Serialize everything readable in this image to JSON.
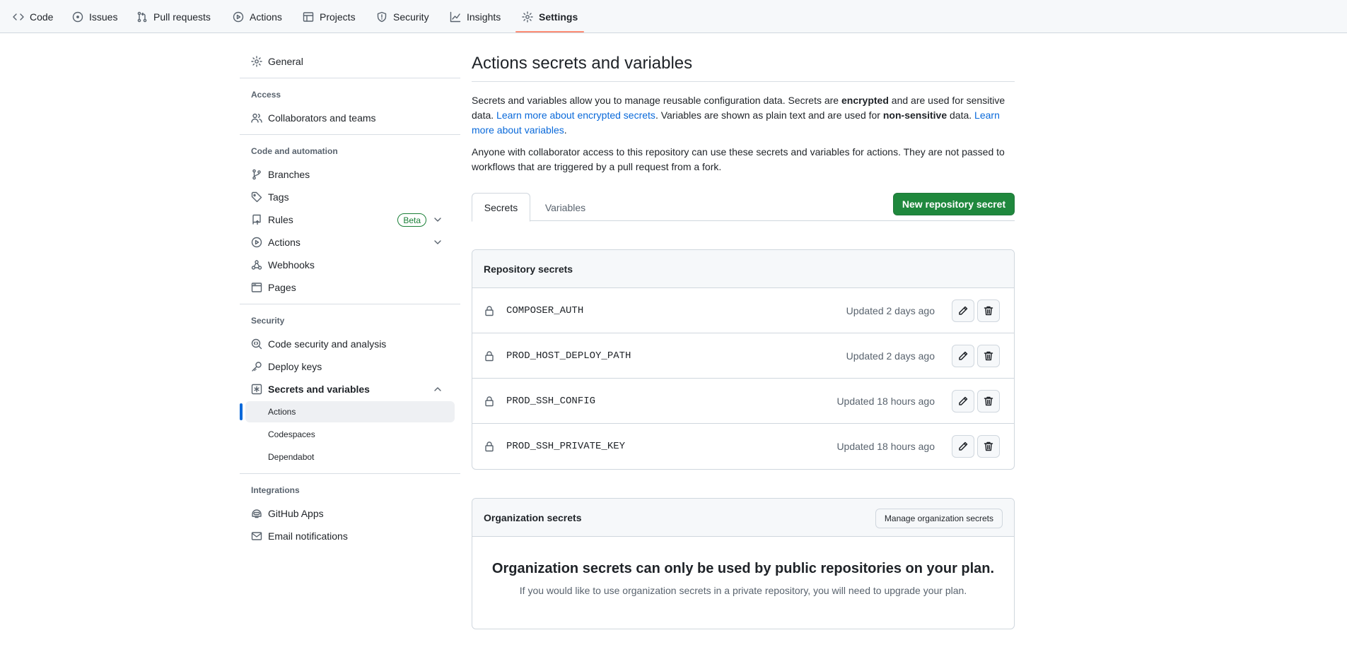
{
  "repo_nav": {
    "tabs": [
      {
        "label": "Code",
        "icon": "code-icon"
      },
      {
        "label": "Issues",
        "icon": "issue-icon"
      },
      {
        "label": "Pull requests",
        "icon": "pull-request-icon"
      },
      {
        "label": "Actions",
        "icon": "play-icon"
      },
      {
        "label": "Projects",
        "icon": "table-icon"
      },
      {
        "label": "Security",
        "icon": "shield-icon"
      },
      {
        "label": "Insights",
        "icon": "graph-icon"
      },
      {
        "label": "Settings",
        "icon": "gear-icon",
        "active": true
      }
    ]
  },
  "sidebar": {
    "general": "General",
    "access_heading": "Access",
    "collaborators": "Collaborators and teams",
    "code_heading": "Code and automation",
    "branches": "Branches",
    "tags": "Tags",
    "rules": "Rules",
    "rules_badge": "Beta",
    "actions": "Actions",
    "webhooks": "Webhooks",
    "pages": "Pages",
    "security_heading": "Security",
    "code_security": "Code security and analysis",
    "deploy_keys": "Deploy keys",
    "secrets_vars": "Secrets and variables",
    "sub_actions": "Actions",
    "sub_codespaces": "Codespaces",
    "sub_dependabot": "Dependabot",
    "integrations_heading": "Integrations",
    "github_apps": "GitHub Apps",
    "email_notifications": "Email notifications"
  },
  "main": {
    "title": "Actions secrets and variables",
    "intro": {
      "p1_a": "Secrets and variables allow you to manage reusable configuration data. Secrets are ",
      "p1_b": "encrypted",
      "p1_c": " and are used for sensitive data. ",
      "p1_link1": "Learn more about encrypted secrets",
      "p1_d": ". Variables are shown as plain text and are used for ",
      "p1_e": "non-sensitive",
      "p1_f": " data. ",
      "p1_link2": "Learn more about variables",
      "p1_g": ".",
      "p2": "Anyone with collaborator access to this repository can use these secrets and variables for actions. They are not passed to workflows that are triggered by a pull request from a fork."
    },
    "tabs": {
      "secrets": "Secrets",
      "variables": "Variables"
    },
    "new_secret_button": "New repository secret",
    "repo_secrets": {
      "heading": "Repository secrets",
      "items": [
        {
          "name": "COMPOSER_AUTH",
          "updated": "Updated 2 days ago"
        },
        {
          "name": "PROD_HOST_DEPLOY_PATH",
          "updated": "Updated 2 days ago"
        },
        {
          "name": "PROD_SSH_CONFIG",
          "updated": "Updated 18 hours ago"
        },
        {
          "name": "PROD_SSH_PRIVATE_KEY",
          "updated": "Updated 18 hours ago"
        }
      ]
    },
    "org_secrets": {
      "heading": "Organization secrets",
      "manage_button": "Manage organization secrets",
      "blank_title": "Organization secrets can only be used by public repositories on your plan.",
      "blank_text": "If you would like to use organization secrets in a private repository, you will need to upgrade your plan."
    }
  }
}
